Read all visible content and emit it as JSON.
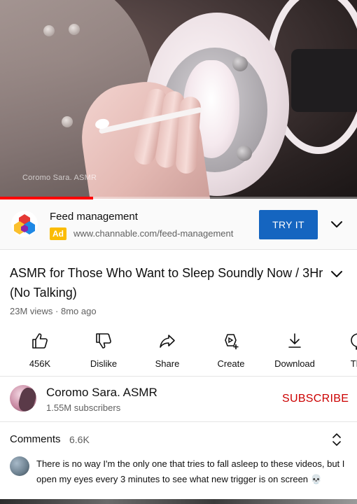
{
  "video": {
    "watermark": "Coromo Sara. ASMR",
    "progress_fraction": 0.26
  },
  "ad": {
    "title": "Feed management",
    "badge": "Ad",
    "url": "www.channable.com/feed-management",
    "cta": "TRY IT"
  },
  "details": {
    "title": "ASMR for Those Who Want to Sleep Soundly Now / 3Hr (No Talking)",
    "meta": "23M views · 8mo ago"
  },
  "actions": [
    {
      "label": "456K",
      "icon": "thumbs-up-icon"
    },
    {
      "label": "Dislike",
      "icon": "thumbs-down-icon"
    },
    {
      "label": "Share",
      "icon": "share-icon"
    },
    {
      "label": "Create",
      "icon": "create-icon"
    },
    {
      "label": "Download",
      "icon": "download-icon"
    },
    {
      "label": "Tha",
      "icon": "thanks-icon"
    }
  ],
  "channel": {
    "name": "Coromo Sara. ASMR",
    "subscribers": "1.55M subscribers",
    "subscribe_label": "SUBSCRIBE"
  },
  "comments": {
    "heading": "Comments",
    "count": "6.6K",
    "top_comment": "There is no way I'm the only one that tries to fall asleep to these videos, but I open my eyes every 3 minutes to see what new trigger is on screen 💀"
  },
  "colors": {
    "progress": "#ff0000",
    "cta_button": "#1565c0",
    "ad_badge": "#fbbc04",
    "subscribe": "#cc0000"
  }
}
